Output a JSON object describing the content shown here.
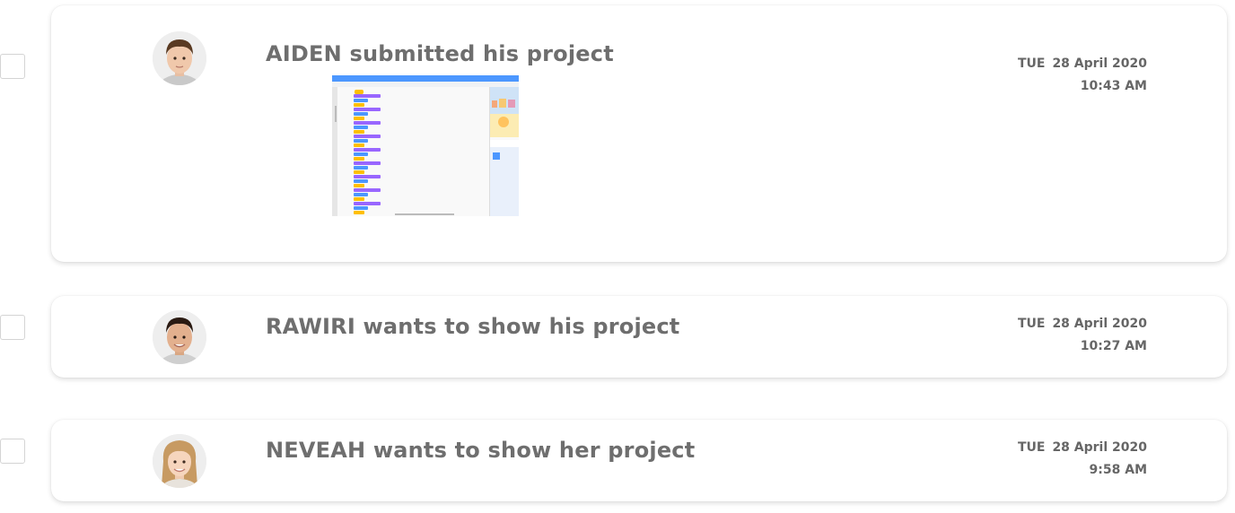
{
  "feed": [
    {
      "title": "AIDEN submitted his project",
      "day": "TUE",
      "date": "28 April 2020",
      "time": "10:43 AM",
      "avatar_icon": "boy-avatar-icon",
      "has_thumbnail": true
    },
    {
      "title": "RAWIRI wants to show his project",
      "day": "TUE",
      "date": "28 April 2020",
      "time": "10:27 AM",
      "avatar_icon": "boy-avatar-icon"
    },
    {
      "title": "NEVEAH wants to show her project",
      "day": "TUE",
      "date": "28 April 2020",
      "time": "9:58 AM",
      "avatar_icon": "girl-avatar-icon"
    }
  ],
  "colors": {
    "title": "#6e6e6e",
    "meta": "#666666",
    "thumb_header": "#4c97ff",
    "block_purple": "#9966ff",
    "block_blue": "#4c97ff",
    "block_yellow": "#ffbf00"
  }
}
